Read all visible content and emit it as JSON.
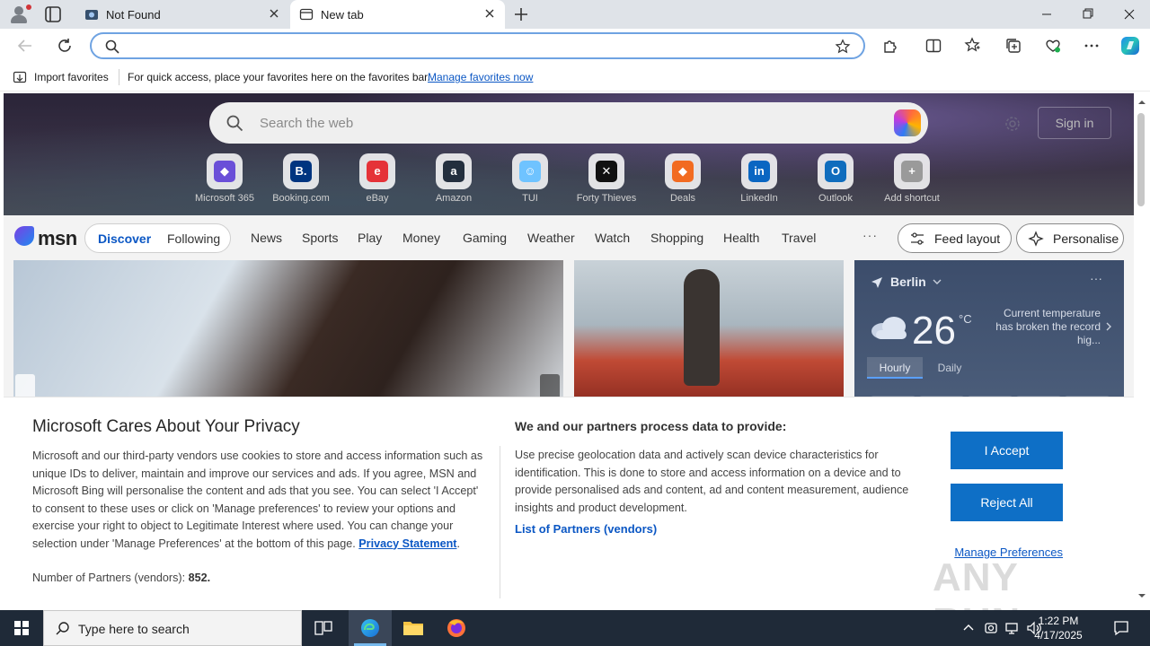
{
  "browser": {
    "tabs": [
      {
        "label": "Not Found",
        "active": false
      },
      {
        "label": "New tab",
        "active": true
      }
    ],
    "address_bar": {
      "value": "",
      "placeholder": ""
    },
    "favorites_bar": {
      "import_label": "Import favorites",
      "message": "For quick access, place your favorites here on the favorites bar.",
      "manage_link": "Manage favorites now"
    }
  },
  "newtab": {
    "search_placeholder": "Search the web",
    "sign_in": "Sign in",
    "shortcuts": [
      {
        "label": "Microsoft 365",
        "color": "#6a4fd8",
        "glyph": "◆"
      },
      {
        "label": "Booking.com",
        "color": "#003580",
        "glyph": "B."
      },
      {
        "label": "eBay",
        "color": "#e53238",
        "glyph": "e"
      },
      {
        "label": "Amazon",
        "color": "#232f3e",
        "glyph": "a"
      },
      {
        "label": "TUI",
        "color": "#6fc3ff",
        "glyph": "☺"
      },
      {
        "label": "Forty Thieves",
        "color": "#111111",
        "glyph": "✕"
      },
      {
        "label": "Deals",
        "color": "#f26b21",
        "glyph": "◆"
      },
      {
        "label": "LinkedIn",
        "color": "#0a66c2",
        "glyph": "in"
      },
      {
        "label": "Outlook",
        "color": "#0f6cbd",
        "glyph": "O"
      },
      {
        "label": "Add shortcut",
        "color": "#9a9a9a",
        "glyph": "+"
      }
    ]
  },
  "msn": {
    "logo": "msn",
    "discover": "Discover",
    "following": "Following",
    "nav": [
      "News",
      "Sports",
      "Play",
      "Money",
      "Gaming",
      "Weather",
      "Watch",
      "Shopping",
      "Health",
      "Travel"
    ],
    "more": "···",
    "feed_layout": "Feed layout",
    "personalise": "Personalise"
  },
  "weather": {
    "city": "Berlin",
    "temperature": "26",
    "unit": "°C",
    "alert": "Current temperature has broken the record hig...",
    "tab_hourly": "Hourly",
    "tab_daily": "Daily"
  },
  "privacy": {
    "title": "Microsoft Cares About Your Privacy",
    "body": "Microsoft and our third-party vendors use cookies to store and access information such as unique IDs to deliver, maintain and improve our services and ads. If you agree, MSN and Microsoft Bing will personalise the content and ads that you see. You can select 'I Accept' to consent to these uses or click on 'Manage preferences' to review your options and exercise your right to object to Legitimate Interest where used.  You can change your selection under 'Manage Preferences' at the bottom of this page.",
    "privacy_statement": "Privacy Statement",
    "partners_label": "Number of Partners (vendors):",
    "partners_count": "852.",
    "data_heading": "We and our partners process data to provide:",
    "data_body": "Use precise geolocation data and actively scan device characteristics for identification. This is done to store and access information on a device and to provide personalised ads and content, ad and content measurement, audience insights and product development.",
    "vendors_link": "List of Partners (vendors)",
    "accept": "I Accept",
    "reject": "Reject All",
    "manage": "Manage Preferences"
  },
  "watermark": "ANY RUN",
  "taskbar": {
    "search_placeholder": "Type here to search",
    "time": "1:22 PM",
    "date": "4/17/2025"
  },
  "colors": {
    "accent": "#0e6fc6",
    "link": "#0b57c4",
    "taskbar": "#1f2a38"
  }
}
